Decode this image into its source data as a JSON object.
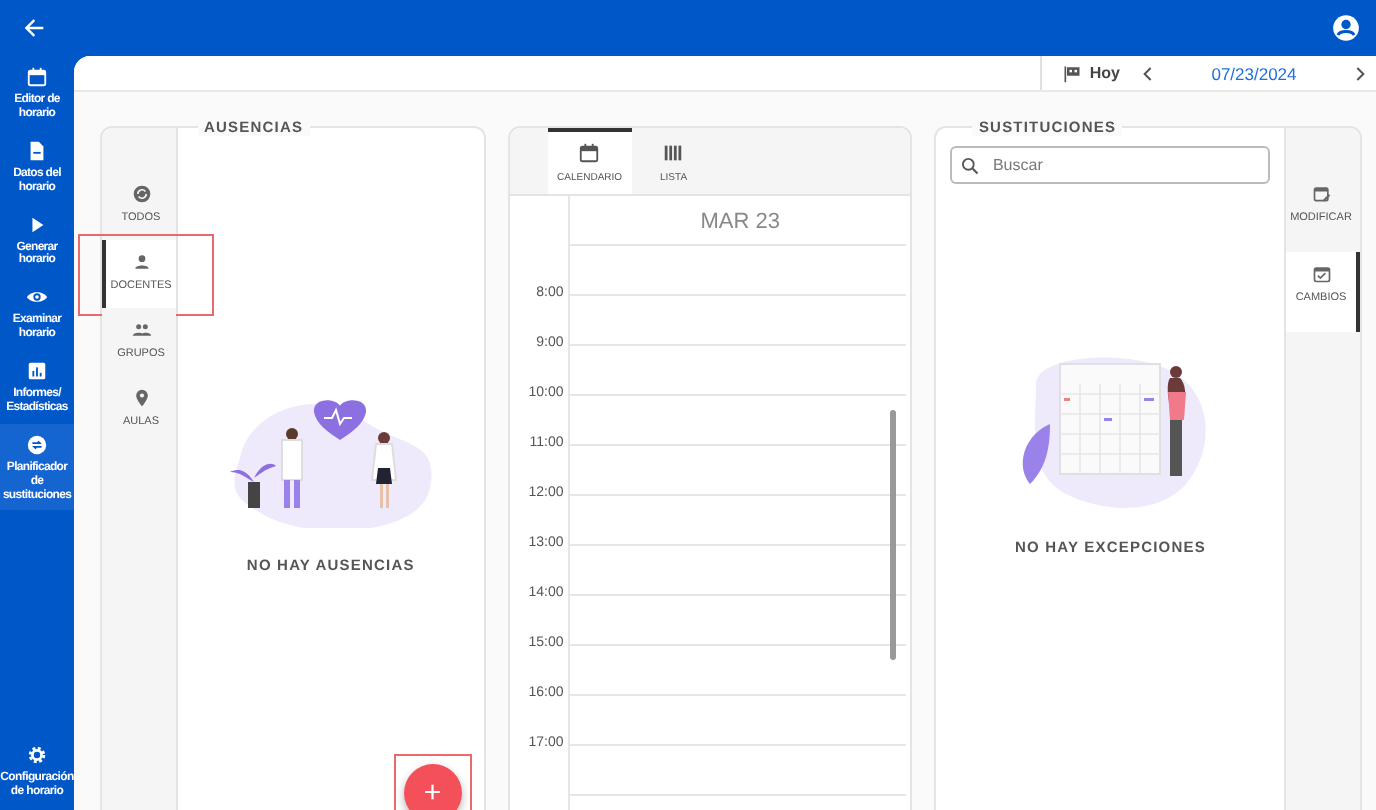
{
  "sidebar": {
    "items": [
      {
        "label": "Editor de horario",
        "selected": false
      },
      {
        "label": "Datos del horario",
        "selected": false
      },
      {
        "label": "Generar horario",
        "selected": false
      },
      {
        "label": "Examinar horario",
        "selected": false
      },
      {
        "label": "Informes/ Estadísticas",
        "selected": false
      },
      {
        "label": "Planificador de sustituciones",
        "selected": true
      }
    ],
    "footer": {
      "label": "Configuración de horario"
    }
  },
  "toolbar": {
    "today": "Hoy",
    "date": "07/23/2024"
  },
  "absences": {
    "title": "AUSENCIAS",
    "tabs": [
      {
        "label": "TODOS",
        "selected": false,
        "highlighted": false
      },
      {
        "label": "DOCENTES",
        "selected": true,
        "highlighted": true
      },
      {
        "label": "GRUPOS",
        "selected": false,
        "highlighted": false
      },
      {
        "label": "AULAS",
        "selected": false,
        "highlighted": false
      }
    ],
    "empty_text": "NO HAY AUSENCIAS",
    "add_button": {
      "label": "+",
      "highlighted": true
    }
  },
  "schedule": {
    "tabs": [
      {
        "label": "CALENDARIO",
        "selected": true
      },
      {
        "label": "LISTA",
        "selected": false
      }
    ],
    "day": "MAR 23",
    "hours": [
      "8:00",
      "9:00",
      "10:00",
      "11:00",
      "12:00",
      "13:00",
      "14:00",
      "15:00",
      "16:00",
      "17:00"
    ]
  },
  "substitutions": {
    "title": "SUSTITUCIONES",
    "search": {
      "placeholder": "Buscar"
    },
    "tabs": [
      {
        "label": "MODIFICAR",
        "selected": false
      },
      {
        "label": "CAMBIOS",
        "selected": true
      }
    ],
    "empty_text": "NO HAY EXCEPCIONES"
  }
}
